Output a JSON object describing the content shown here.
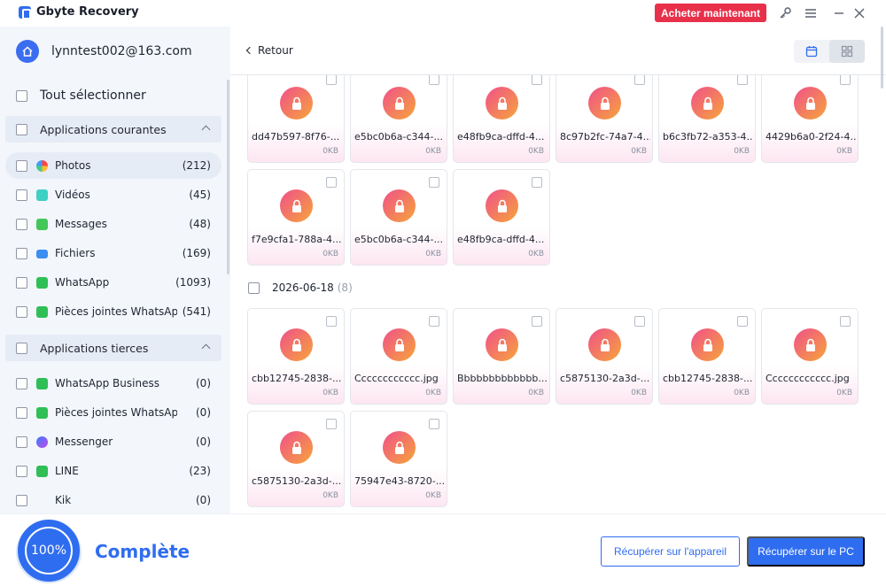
{
  "app": {
    "title": "Gbyte Recovery",
    "buy_label": "Acheter maintenant"
  },
  "sidebar": {
    "account_email": "lynntest002@163.com",
    "select_all_label": "Tout sélectionner",
    "groups": [
      {
        "label": "Applications courantes",
        "items": [
          {
            "label": "Photos",
            "count": "(212)",
            "icon": "photos-icon",
            "active": true
          },
          {
            "label": "Vidéos",
            "count": "(45)",
            "icon": "videos-icon"
          },
          {
            "label": "Messages",
            "count": "(48)",
            "icon": "messages-icon"
          },
          {
            "label": "Fichiers",
            "count": "(169)",
            "icon": "files-icon"
          },
          {
            "label": "WhatsApp",
            "count": "(1093)",
            "icon": "whatsapp-icon"
          },
          {
            "label": "Pièces jointes WhatsApp",
            "count": "(541)",
            "icon": "whatsapp-attachments-icon"
          }
        ]
      },
      {
        "label": "Applications tierces",
        "items": [
          {
            "label": "WhatsApp Business",
            "count": "(0)",
            "icon": "whatsapp-business-icon"
          },
          {
            "label": "Pièces jointes WhatsApp B...",
            "count": "(0)",
            "icon": "whatsapp-business-attachments-icon"
          },
          {
            "label": "Messenger",
            "count": "(0)",
            "icon": "messenger-icon"
          },
          {
            "label": "LINE",
            "count": "(23)",
            "icon": "line-icon"
          },
          {
            "label": "Kik",
            "count": "(0)",
            "icon": "kik-icon"
          }
        ]
      }
    ]
  },
  "main": {
    "back_label": "Retour",
    "sections": [
      {
        "date": "",
        "files": [
          {
            "name": "dd47b597-8f76-...",
            "size": "0KB"
          },
          {
            "name": "e5bc0b6a-c344-...",
            "size": "0KB"
          },
          {
            "name": "e48fb9ca-dffd-4...",
            "size": "0KB"
          },
          {
            "name": "8c97b2fc-74a7-4...",
            "size": "0KB"
          },
          {
            "name": "b6c3fb72-a353-4...",
            "size": "0KB"
          },
          {
            "name": "4429b6a0-2f24-4...",
            "size": "0KB"
          },
          {
            "name": "f7e9cfa1-788a-4...",
            "size": "0KB"
          },
          {
            "name": "e5bc0b6a-c344-...",
            "size": "0KB"
          },
          {
            "name": "e48fb9ca-dffd-4...",
            "size": "0KB"
          }
        ]
      },
      {
        "date": "2026-06-18",
        "count": "(8)",
        "files": [
          {
            "name": "cbb12745-2838-...",
            "size": "0KB"
          },
          {
            "name": "Cccccccccccc.jpg",
            "size": "0KB"
          },
          {
            "name": "Bbbbbbbbbbbbb...",
            "size": "0KB"
          },
          {
            "name": "c5875130-2a3d-...",
            "size": "0KB"
          },
          {
            "name": "cbb12745-2838-...",
            "size": "0KB"
          },
          {
            "name": "Cccccccccccc.jpg",
            "size": "0KB"
          },
          {
            "name": "c5875130-2a3d-...",
            "size": "0KB"
          },
          {
            "name": "75947e43-8720-...",
            "size": "0KB"
          }
        ]
      }
    ]
  },
  "footer": {
    "progress_label": "100%",
    "progress": 1.0,
    "status": "Complète",
    "recover_device_label": "Récupérer sur l'appareil",
    "recover_pc_label": "Récupérer sur le PC"
  },
  "colors": {
    "accent": "#2f6df0",
    "buy": "#e8304a"
  }
}
